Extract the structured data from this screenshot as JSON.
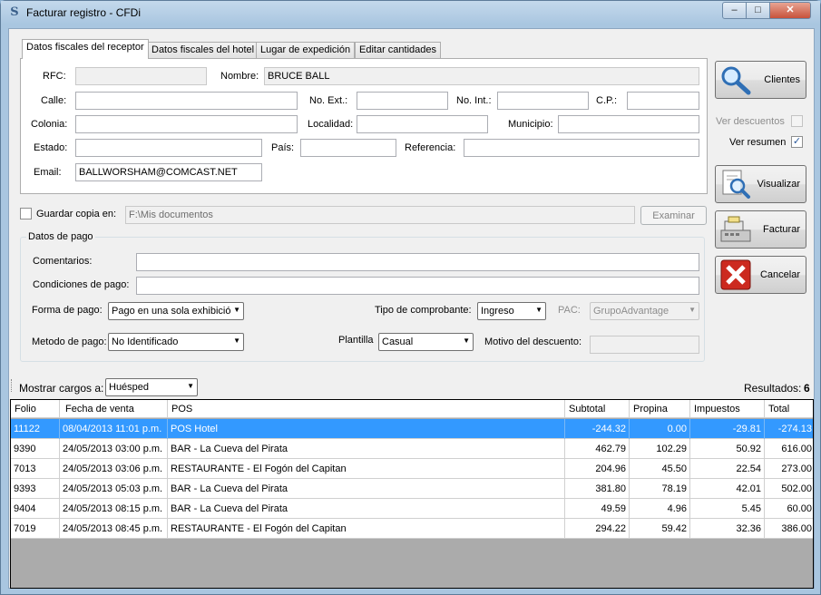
{
  "window": {
    "title": "Facturar registro - CFDi",
    "icon_letter": "S",
    "min_glyph": "–",
    "max_glyph": "□",
    "close_glyph": "✕"
  },
  "tabs": [
    {
      "label": "Datos fiscales del receptor",
      "active": true
    },
    {
      "label": "Datos fiscales del hotel",
      "active": false
    },
    {
      "label": "Lugar de expedición",
      "active": false
    },
    {
      "label": "Editar cantidades",
      "active": false
    }
  ],
  "receptor": {
    "rfc_label": "RFC:",
    "rfc_value": "",
    "nombre_label": "Nombre:",
    "nombre_value": "BRUCE BALL",
    "calle_label": "Calle:",
    "calle_value": "",
    "noext_label": "No. Ext.:",
    "noext_value": "",
    "noint_label": "No. Int.:",
    "noint_value": "",
    "cp_label": "C.P.:",
    "cp_value": "",
    "colonia_label": "Colonia:",
    "colonia_value": "",
    "localidad_label": "Localidad:",
    "localidad_value": "",
    "municipio_label": "Municipio:",
    "municipio_value": "",
    "estado_label": "Estado:",
    "estado_value": "",
    "pais_label": "País:",
    "pais_value": "",
    "referencia_label": "Referencia:",
    "referencia_value": "",
    "email_label": "Email:",
    "email_value": "BALLWORSHAM@COMCAST.NET"
  },
  "side": {
    "clientes_label": "Clientes",
    "ver_descuentos_label": "Ver descuentos",
    "ver_descuentos_checked": false,
    "ver_resumen_label": "Ver resumen",
    "ver_resumen_checked": true,
    "visualizar_label": "Visualizar",
    "facturar_label": "Facturar",
    "cancelar_label": "Cancelar",
    "check_glyph": "✓"
  },
  "copia": {
    "label": "Guardar copia en:",
    "checked": false,
    "path": "F:\\Mis documentos",
    "examinar_label": "Examinar"
  },
  "pago": {
    "group_title": "Datos de pago",
    "comentarios_label": "Comentarios:",
    "comentarios_value": "",
    "condiciones_label": "Condiciones de pago:",
    "condiciones_value": "",
    "forma_label": "Forma de pago:",
    "forma_value": "Pago en una sola exhibició",
    "tipo_label": "Tipo de comprobante:",
    "tipo_value": "Ingreso",
    "pac_label": "PAC:",
    "pac_value": "GrupoAdvantage",
    "metodo_label": "Metodo de pago:",
    "metodo_value": "No Identificado",
    "plantilla_label": "Plantilla",
    "plantilla_value": "Casual",
    "motivo_label": "Motivo del descuento:",
    "motivo_value": "",
    "arrow_glyph": "▼"
  },
  "filter": {
    "mostrar_label": "Mostrar cargos a:",
    "mostrar_value": "Huésped",
    "resultados_label": "Resultados:",
    "resultados_value": "6"
  },
  "table": {
    "columns": [
      "Folio",
      "Fecha de venta",
      "POS",
      "Subtotal",
      "Propina",
      "Impuestos",
      "Total"
    ],
    "rows": [
      [
        "11122",
        "08/04/2013 11:01 p.m.",
        "POS Hotel",
        "-244.32",
        "0.00",
        "-29.81",
        "-274.13"
      ],
      [
        "9390",
        "24/05/2013 03:00 p.m.",
        "BAR - La Cueva del Pirata",
        "462.79",
        "102.29",
        "50.92",
        "616.00"
      ],
      [
        "7013",
        "24/05/2013 03:06 p.m.",
        "RESTAURANTE - El Fogón del Capitan",
        "204.96",
        "45.50",
        "22.54",
        "273.00"
      ],
      [
        "9393",
        "24/05/2013 05:03 p.m.",
        "BAR - La Cueva del Pirata",
        "381.80",
        "78.19",
        "42.01",
        "502.00"
      ],
      [
        "9404",
        "24/05/2013 08:15 p.m.",
        "BAR - La Cueva del Pirata",
        "49.59",
        "4.96",
        "5.45",
        "60.00"
      ],
      [
        "7019",
        "24/05/2013 08:45 p.m.",
        "RESTAURANTE - El Fogón del Capitan",
        "294.22",
        "59.42",
        "32.36",
        "386.00"
      ]
    ],
    "selected_row": 0
  }
}
